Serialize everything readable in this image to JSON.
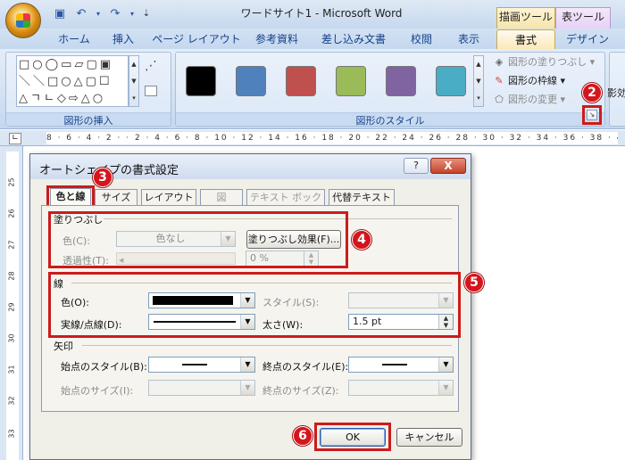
{
  "window": {
    "title": "ワードサイト1 - Microsoft Word"
  },
  "contextual_tabs": [
    "描画ツール",
    "表ツール"
  ],
  "ribbon_tabs": [
    "ホーム",
    "挿入",
    "ページ レイアウト",
    "参考資料",
    "差し込み文書",
    "校閲",
    "表示",
    "書式",
    "デザイン"
  ],
  "active_tab": "書式",
  "ribbon": {
    "insert_shapes_label": "図形の挿入",
    "shapes_glyphs": [
      "□○◯▭▱▢▣",
      "＼＼□○△▢☐",
      "△ㄱㄴ◇⇨△○"
    ],
    "shape_styles_label": "図形のスタイル",
    "swatch_colors": [
      "#000000",
      "#4f81bd",
      "#c0504d",
      "#9bbb59",
      "#8064a2",
      "#4bacc6"
    ],
    "fill_label": "図形の塗りつぶし",
    "outline_label": "図形の枠線",
    "change_label": "図形の変更",
    "shadow_label": "影効"
  },
  "ruler": {
    "marks": "8 · 6 · 4 · 2 ·   · 2 · 4 · 6 · 8 · 10 · 12 · 14 · 16 · 18 · 20 · 22 · 24 · 26 · 28 · 30 · 32 · 34 · 36 · 38 · 40 · 42 · 44"
  },
  "vruler_numbers": [
    "25",
    "26",
    "27",
    "28",
    "29",
    "30",
    "31",
    "32",
    "33"
  ],
  "dialog": {
    "title": "オートシェイプの書式設定",
    "help": "?",
    "close": "X",
    "tabs": [
      "色と線",
      "サイズ",
      "レイアウト",
      "図",
      "テキスト ボックス",
      "代替テキスト"
    ],
    "fill": {
      "title": "塗りつぶし",
      "color_label": "色(C):",
      "color_value": "色なし",
      "effects_button": "塗りつぶし効果(F)...",
      "transparency_label": "透過性(T):",
      "transparency_value": "0 %"
    },
    "line": {
      "title": "線",
      "color_label": "色(O):",
      "dash_label": "実線/点線(D):",
      "style_label": "スタイル(S):",
      "weight_label": "太さ(W):",
      "weight_value": "1.5 pt"
    },
    "arrows": {
      "title": "矢印",
      "begin_style_label": "始点のスタイル(B):",
      "begin_size_label": "始点のサイズ(I):",
      "end_style_label": "終点のスタイル(E):",
      "end_size_label": "終点のサイズ(Z):"
    },
    "ok": "OK",
    "cancel": "キャンセル"
  },
  "callouts": [
    "2",
    "3",
    "4",
    "5",
    "6"
  ],
  "colors": {
    "callout_red": "#cc1b1b"
  }
}
